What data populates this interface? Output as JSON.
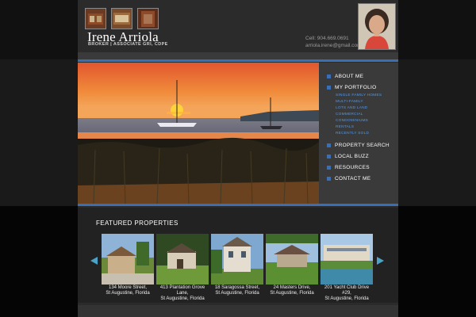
{
  "site": {
    "name": "Irene Arriola",
    "subtitle": "BROKER | ASSOCIATE GRI, CDPE",
    "phone": "Cell: 904.669.0691",
    "email": "arriola.irene@gmail.com"
  },
  "nav": {
    "items": [
      {
        "label": "ABOUT ME"
      },
      {
        "label": "MY PORTFOLIO"
      },
      {
        "label": "PROPERTY SEARCH"
      },
      {
        "label": "LOCAL BUZZ"
      },
      {
        "label": "RESOURCES"
      },
      {
        "label": "CONTACT ME"
      }
    ],
    "portfolio_sub": [
      "SINGLE FAMILY HOMES",
      "MULTI-FAMILY",
      "LOTS AND LAND",
      "COMMERCIAL",
      "CONDOMINIUMS",
      "RENTALS",
      "RECENTLY SOLD"
    ]
  },
  "featured": {
    "title": "FEATURED PROPERTIES",
    "properties": [
      {
        "line1": "134 Moore Street,",
        "line2": "St Augustine, Florida",
        "line3": ""
      },
      {
        "line1": "413 Plantation Grove",
        "line2": "Lane,",
        "line3": "St Augustine, Florida"
      },
      {
        "line1": "18 Saragossa Street,",
        "line2": "St Augustine, Florida",
        "line3": ""
      },
      {
        "line1": "24 Masters Drive,",
        "line2": "St Augustine, Florida",
        "line3": ""
      },
      {
        "line1": "201 Yacht Club Drive",
        "line2": "#29,",
        "line3": "St Augustine, Florida"
      }
    ]
  },
  "colors": {
    "accent": "#3b6fb5",
    "arrow": "#4aa3c8",
    "submenu": "#5b95d8"
  },
  "icons": {
    "prev": "arrow-left-icon",
    "next": "arrow-right-icon",
    "bullet": "square-bullet-icon"
  }
}
